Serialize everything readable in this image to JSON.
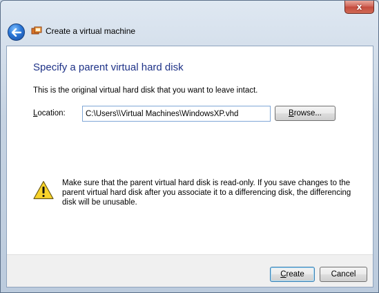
{
  "window": {
    "title": "Create a virtual machine",
    "close_glyph": "x"
  },
  "page": {
    "heading": "Specify a parent virtual hard disk",
    "description": "This is the original virtual hard disk that you want to leave intact.",
    "location_label_prefix": "L",
    "location_label_rest": "ocation:",
    "location_value": "C:\\Users\\\\Virtual Machines\\WindowsXP.vhd",
    "browse_prefix": "B",
    "browse_rest": "rowse...",
    "warning_text": "Make sure that the parent virtual hard disk is read-only. If you save changes to the parent virtual hard disk after you associate it to a differencing disk, the differencing disk will be unusable."
  },
  "footer": {
    "create_prefix": "C",
    "create_rest": "reate",
    "cancel_label": "Cancel"
  },
  "icons": {
    "back": "back-arrow-icon",
    "app": "virtual-machine-icon",
    "warning": "warning-icon"
  },
  "colors": {
    "heading": "#1e3287",
    "close_button": "#c44c3e",
    "back_button": "#2a76d6"
  }
}
